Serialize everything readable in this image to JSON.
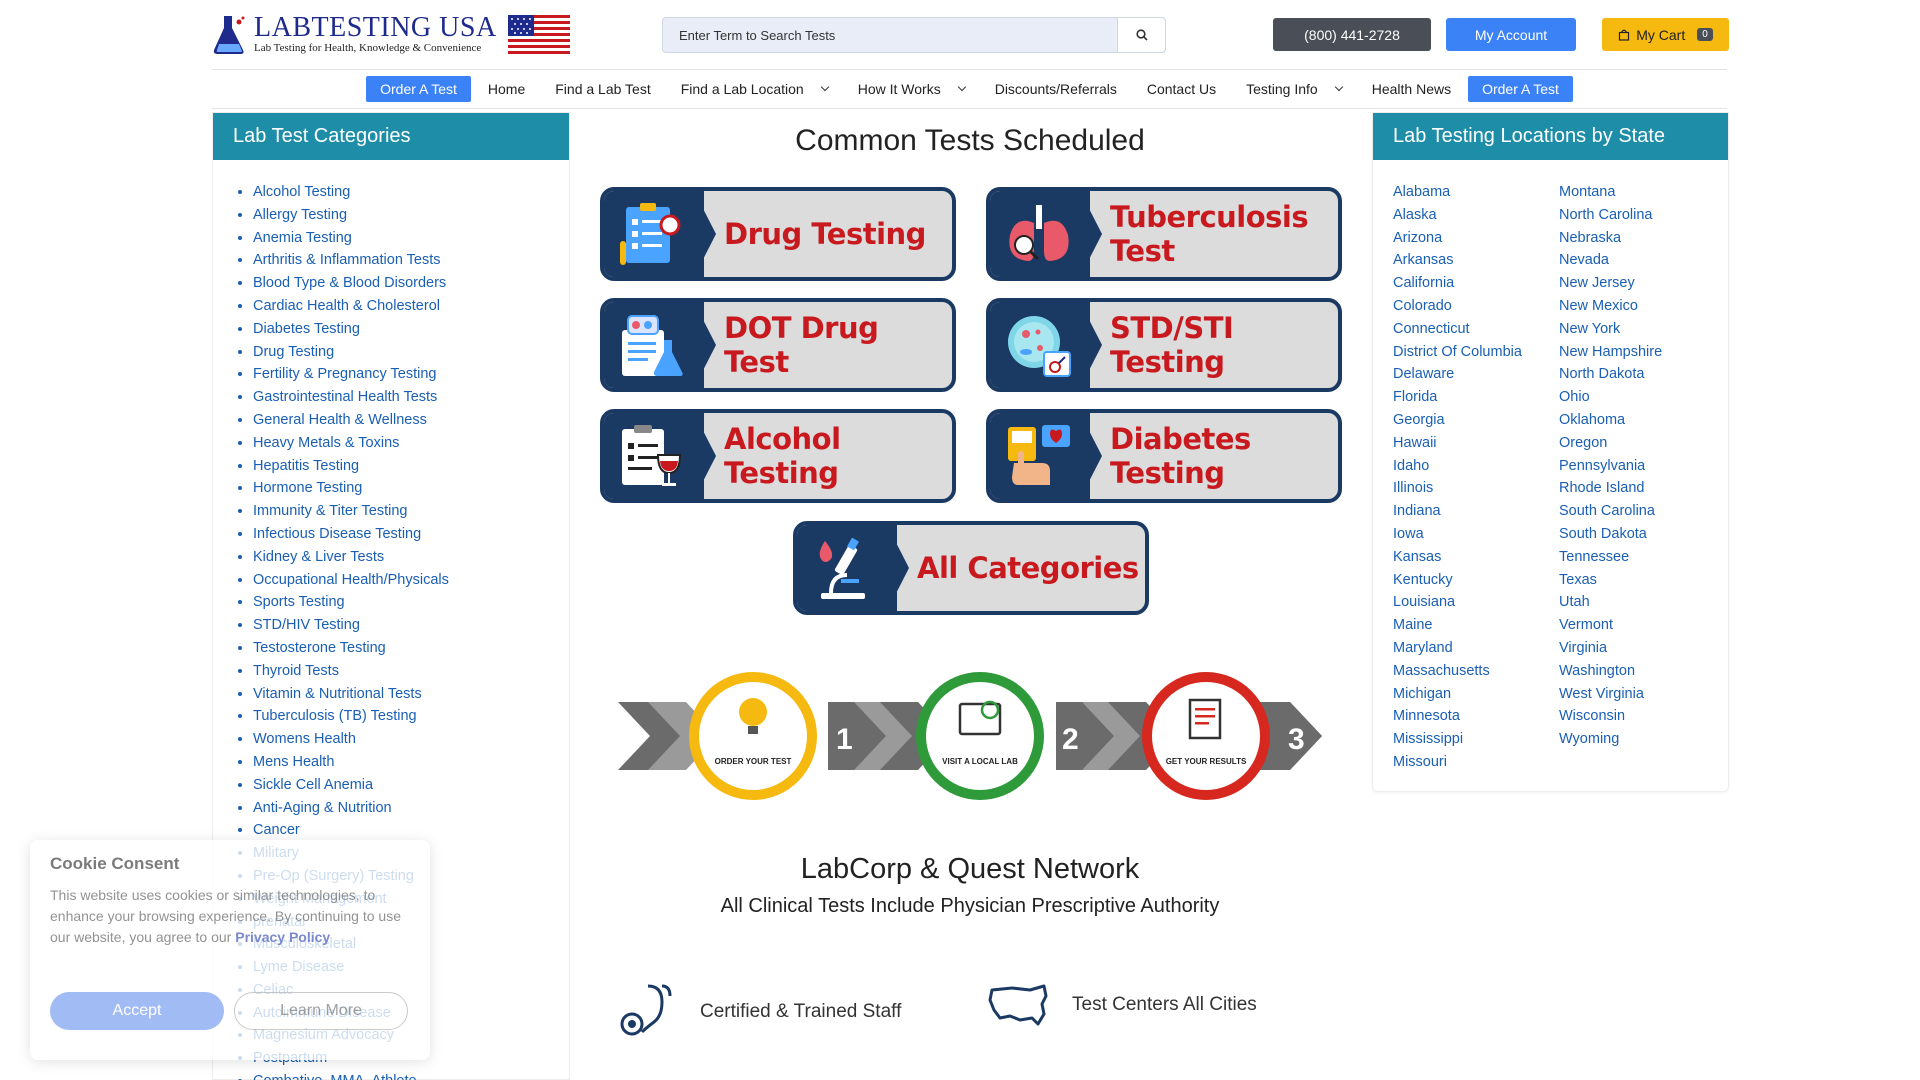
{
  "brand": {
    "name": "LABTESTING USA",
    "tagline": "Lab Testing for Health, Knowledge & Convenience"
  },
  "search": {
    "placeholder": "Enter Term to Search Tests"
  },
  "header": {
    "phone": "(800) 441-2728",
    "account": "My Account",
    "cart": "My Cart",
    "cart_count": "0"
  },
  "nav": {
    "order_left": "Order A Test",
    "home": "Home",
    "find_test": "Find a Lab Test",
    "find_location": "Find a Lab Location",
    "how_it_works": "How It Works",
    "discounts": "Discounts/Referrals",
    "contact": "Contact Us",
    "testing_info": "Testing Info",
    "health_news": "Health News",
    "order_right": "Order A Test"
  },
  "categories": {
    "heading": "Lab Test Categories",
    "items": [
      "Alcohol Testing",
      "Allergy Testing",
      "Anemia Testing",
      "Arthritis & Inflammation Tests",
      "Blood Type & Blood Disorders",
      "Cardiac Health & Cholesterol",
      "Diabetes Testing",
      "Drug Testing",
      "Fertility & Pregnancy Testing",
      "Gastrointestinal Health Tests",
      "General Health & Wellness",
      "Heavy Metals & Toxins",
      "Hepatitis Testing",
      "Hormone Testing",
      "Immunity & Titer Testing",
      "Infectious Disease Testing",
      "Kidney & Liver Tests",
      "Occupational Health/Physicals",
      "Sports Testing",
      "STD/HIV Testing",
      "Testosterone Testing",
      "Thyroid Tests",
      "Vitamin & Nutritional Tests",
      "Tuberculosis (TB) Testing",
      "Womens Health",
      "Mens Health",
      "Sickle Cell Anemia",
      "Anti-Aging & Nutrition",
      "Cancer",
      "Military",
      "Pre-Op (Surgery) Testing",
      "Weight Management",
      "prenatal",
      "Musculoskeletal",
      "Lyme Disease",
      "Celiac",
      "Autoimmune Disease",
      "Magnesium Advocacy",
      "Postpartum",
      "Combative, MMA, Athlete"
    ]
  },
  "common": {
    "title": "Common Tests Scheduled",
    "tiles": {
      "drug": "Drug Testing",
      "tb": "Tuberculosis Test",
      "dot": "DOT Drug Test",
      "std": "STD/STI Testing",
      "alcohol": "Alcohol Testing",
      "diabetes": "Diabetes Testing",
      "all": "All Categories"
    }
  },
  "steps": {
    "s1": "ORDER YOUR TEST",
    "n1": "1",
    "s2": "VISIT A LOCAL LAB",
    "n2": "2",
    "s3": "GET YOUR RESULTS",
    "n3": "3"
  },
  "network": {
    "title": "LabCorp & Quest Network",
    "subtitle": "All Clinical Tests Include Physician Prescriptive Authority",
    "features": [
      "Certified & Trained Staff",
      "Test Centers All Cities"
    ]
  },
  "locations": {
    "heading": "Lab Testing Locations by State",
    "col1": [
      "Alabama",
      "Alaska",
      "Arizona",
      "Arkansas",
      "California",
      "Colorado",
      "Connecticut",
      "District Of Columbia",
      "Delaware",
      "Florida",
      "Georgia",
      "Hawaii",
      "Idaho",
      "Illinois",
      "Indiana",
      "Iowa",
      "Kansas",
      "Kentucky",
      "Louisiana",
      "Maine",
      "Maryland",
      "Massachusetts",
      "Michigan",
      "Minnesota",
      "Mississippi",
      "Missouri"
    ],
    "col2": [
      "Montana",
      "North Carolina",
      "Nebraska",
      "Nevada",
      "New Jersey",
      "New Mexico",
      "New York",
      "New Hampshire",
      "North Dakota",
      "Ohio",
      "Oklahoma",
      "Oregon",
      "Pennsylvania",
      "Rhode Island",
      "South Carolina",
      "South Dakota",
      "Tennessee",
      "Texas",
      "Utah",
      "Vermont",
      "Virginia",
      "Washington",
      "West Virginia",
      "Wisconsin",
      "Wyoming"
    ]
  },
  "cookie": {
    "title": "Cookie Consent",
    "text": "This website uses cookies or similar technologies, to enhance your browsing experience. By continuing to use our website, you agree to our",
    "link": "Privacy Policy",
    "accept": "Accept",
    "learn": "Learn More"
  },
  "colors": {
    "primary": "#3b82f6",
    "teal": "#1e8ea8",
    "link": "#1a5fb4",
    "tile_navy": "#1b3a63",
    "tile_red": "#c8191e",
    "cart_yellow": "#f6b90f"
  }
}
